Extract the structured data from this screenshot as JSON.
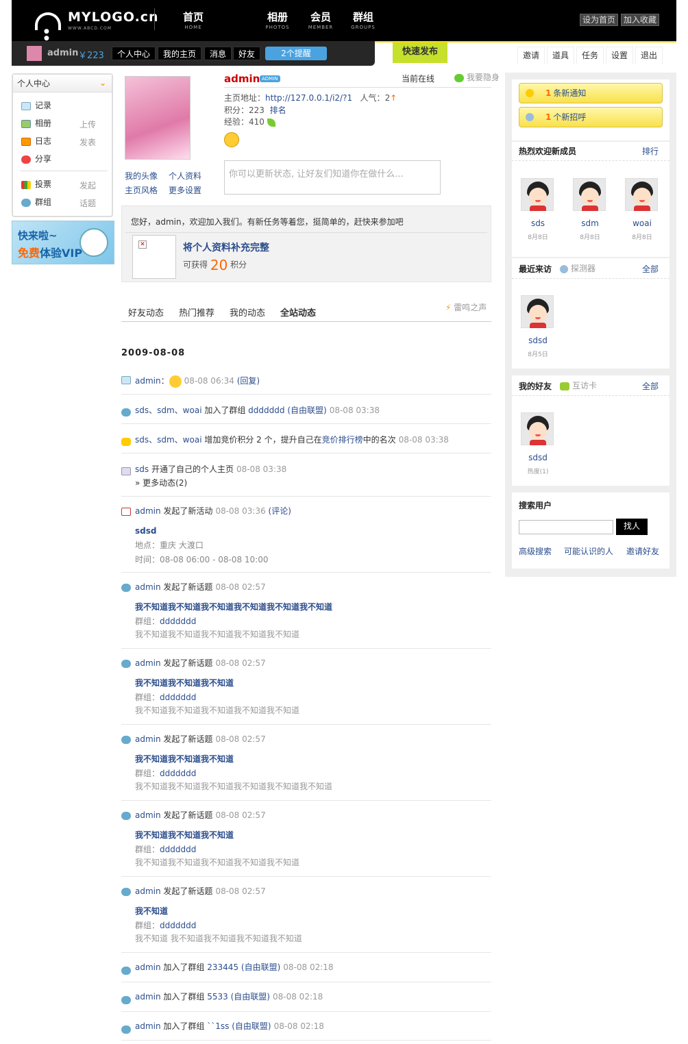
{
  "header": {
    "logo": "MYLOGO.cn",
    "logo_sub": "WWW.ABCD.COM",
    "nav": [
      {
        "cn": "首页",
        "en": "HOME"
      },
      {
        "cn": "相册",
        "en": "PHOTOS"
      },
      {
        "cn": "会员",
        "en": "MEMBER"
      },
      {
        "cn": "群组",
        "en": "GROUPS"
      }
    ],
    "set_home": "设为首页",
    "add_fav": "加入收藏"
  },
  "userbar": {
    "username": "admin",
    "money": "￥223",
    "links": [
      "个人中心",
      "我的主页",
      "消息",
      "好友"
    ],
    "remind": "2个提醒",
    "quick_publish": "快速发布",
    "right_tabs": [
      "邀请",
      "道具",
      "任务",
      "设置",
      "退出"
    ]
  },
  "sidebar": {
    "title": "个人中心",
    "items": [
      {
        "label": "记录",
        "sub": ""
      },
      {
        "label": "相册",
        "sub": "上传"
      },
      {
        "label": "日志",
        "sub": "发表"
      },
      {
        "label": "分享",
        "sub": ""
      },
      {
        "label": "投票",
        "sub": "发起"
      },
      {
        "label": "群组",
        "sub": "话题"
      }
    ],
    "banner_line1": "快来啦~",
    "banner_free": "免费",
    "banner_rest": "体验VIP"
  },
  "profile": {
    "name": "admin",
    "badge": "ADMIN",
    "online": "当前在线",
    "hide": "我要隐身",
    "home_label": "主页地址：",
    "home_url": "http://127.0.0.1/i2/?1",
    "pop_label": "人气：",
    "pop_value": "2",
    "score_label": "积分：",
    "score_value": "223",
    "rank": "排名",
    "exp_label": "经验：",
    "exp_value": "410",
    "links": [
      "我的头像",
      "个人资料",
      "主页风格",
      "更多设置"
    ],
    "status_placeholder": "你可以更新状态, 让好友们知道你在做什么..."
  },
  "welcome": {
    "message": "您好，admin，欢迎加入我们。有新任务等着您，挺简单的，赶快来参加吧",
    "task": "将个人资料补充完整",
    "gain": "可获得",
    "points": "20",
    "points_unit": "积分"
  },
  "feed_tabs": [
    "好友动态",
    "热门推荐",
    "我的动态",
    "全站动态"
  ],
  "thunder": "雷鸣之声",
  "date": "2009-08-08",
  "feed": [
    {
      "user": "admin",
      "text": "：",
      "time": "08-08 06:34",
      "extra": "(回复)"
    },
    {
      "user": "sds、sdm、woai",
      "text": " 加入了群组 ",
      "obj": "ddddddd",
      "extra": "(自由联盟)",
      "time": "08-08 03:38"
    },
    {
      "user": "sds、sdm、woai",
      "text": " 增加竞价积分 2 个，提升自己在",
      "obj": "竞价排行榜",
      "text2": "中的名次",
      "time": "08-08 03:38"
    },
    {
      "user": "sds",
      "text": " 开通了自己的个人主页",
      "time": "08-08 03:38",
      "more": "» 更多动态(2)"
    },
    {
      "user": "admin",
      "text": " 发起了新活动",
      "time": "08-08 03:36",
      "extra": "(评论)",
      "title": "sdsd",
      "place": "地点：重庆 大渡口",
      "when": "时间：08-08 06:00 - 08-08 10:00"
    },
    {
      "user": "admin",
      "text": " 发起了新话题",
      "time": "08-08 02:57",
      "title": "我不知道我不知道我不知道我不知道我不知道我不知道",
      "group_label": "群组：",
      "group": "ddddddd",
      "body": "我不知道我不知道我不知道我不知道我不知道"
    },
    {
      "user": "admin",
      "text": " 发起了新话题",
      "time": "08-08 02:57",
      "title": "我不知道我不知道我不知道",
      "group_label": "群组：",
      "group": "ddddddd",
      "body": "我不知道我不知道我不知道我不知道我不知道"
    },
    {
      "user": "admin",
      "text": " 发起了新话题",
      "time": "08-08 02:57",
      "title": "我不知道我不知道我不知道",
      "group_label": "群组：",
      "group": "ddddddd",
      "body": "我不知道我不知道我不知道我不知道我不知道我不知道"
    },
    {
      "user": "admin",
      "text": " 发起了新话题",
      "time": "08-08 02:57",
      "title": "我不知道我不知道我不知道",
      "group_label": "群组：",
      "group": "ddddddd",
      "body": "我不知道我不知道我不知道我不知道我不知道"
    },
    {
      "user": "admin",
      "text": " 发起了新话题",
      "time": "08-08 02:57",
      "title": "我不知道",
      "group_label": "群组：",
      "group": "ddddddd",
      "body": "我不知道 我不知道我不知道我不知道我不知道"
    },
    {
      "user": "admin",
      "text": " 加入了群组 ",
      "obj": "233445",
      "extra": "(自由联盟)",
      "time": "08-08 02:18"
    },
    {
      "user": "admin",
      "text": " 加入了群组 ",
      "obj": "5533",
      "extra": "(自由联盟)",
      "time": "08-08 02:18"
    },
    {
      "user": "admin",
      "text": " 加入了群组 ",
      "obj": "``1ss",
      "extra": "(自由联盟)",
      "time": "08-08 02:18"
    }
  ],
  "right": {
    "notice_count": "1",
    "notice_text": "条新通知",
    "greet_count": "1",
    "greet_text": "个新招呼",
    "new_members_title": "热烈欢迎新成员",
    "new_members_more": "排行",
    "new_members": [
      {
        "name": "sds",
        "date": "8月8日"
      },
      {
        "name": "sdm",
        "date": "8月8日"
      },
      {
        "name": "woai",
        "date": "8月8日"
      }
    ],
    "visitors_title": "最近来访",
    "visitors_tool": "探测器",
    "visitors_more": "全部",
    "visitors": [
      {
        "name": "sdsd",
        "date": "8月5日"
      }
    ],
    "friends_title": "我的好友",
    "friends_tool": "互访卡",
    "friends_more": "全部",
    "friends": [
      {
        "name": "sdsd",
        "date": "热度(1)"
      }
    ],
    "search_title": "搜索用户",
    "search_button": "找人",
    "search_links": [
      "高级搜索",
      "可能认识的人",
      "邀请好友"
    ]
  }
}
